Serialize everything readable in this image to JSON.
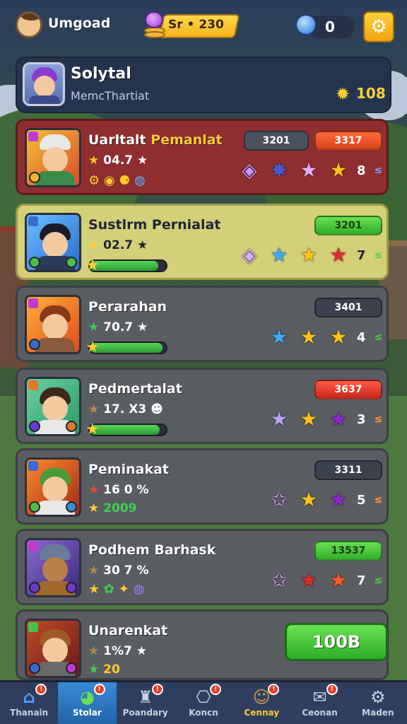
{
  "topbar": {
    "username": "Umgoad",
    "currency": "Sr • 230",
    "orb_count": "0"
  },
  "profile": {
    "name": "Solytal",
    "subtitle": "MemcThartiat",
    "score": "108"
  },
  "cards": [
    {
      "name": "Uarltalt",
      "name_accent": "Pemanlat",
      "stat": "04.7",
      "badge1": "3201",
      "badge2": "3317",
      "count": "8",
      "colors": {
        "bg": "#8e2e2f"
      }
    },
    {
      "name": "Sustlrm Pernialat",
      "stat": "02.7",
      "badge": "3201",
      "count": "7",
      "progress": 0.9
    },
    {
      "name": "Perarahan",
      "stat": "70.7",
      "badge": "3401",
      "count": "4",
      "progress": 0.95
    },
    {
      "name": "Pedmertalat",
      "stat": "17. X3",
      "badge": "3637",
      "count": "3",
      "progress": 0.92
    },
    {
      "name": "Peminakat",
      "stat": "16 0",
      "stat2": "2009",
      "badge": "3311",
      "count": "5"
    },
    {
      "name": "Podhem Barhask",
      "stat": "30 7",
      "badge": "13537",
      "count": "7"
    },
    {
      "name": "Unarenkat",
      "stat": "1%7",
      "stat2": "20",
      "claim_label": "100B"
    }
  ],
  "nav": [
    {
      "label": "Thanain",
      "icon": "home-icon"
    },
    {
      "label": "Stolar",
      "icon": "globe-icon"
    },
    {
      "label": "Poandary",
      "icon": "team-icon"
    },
    {
      "label": "Koncn",
      "icon": "shop-icon"
    },
    {
      "label": "Cennay",
      "icon": "pet-icon"
    },
    {
      "label": "Ceonan",
      "icon": "mail-icon"
    },
    {
      "label": "Maden",
      "icon": "gear-icon"
    }
  ]
}
